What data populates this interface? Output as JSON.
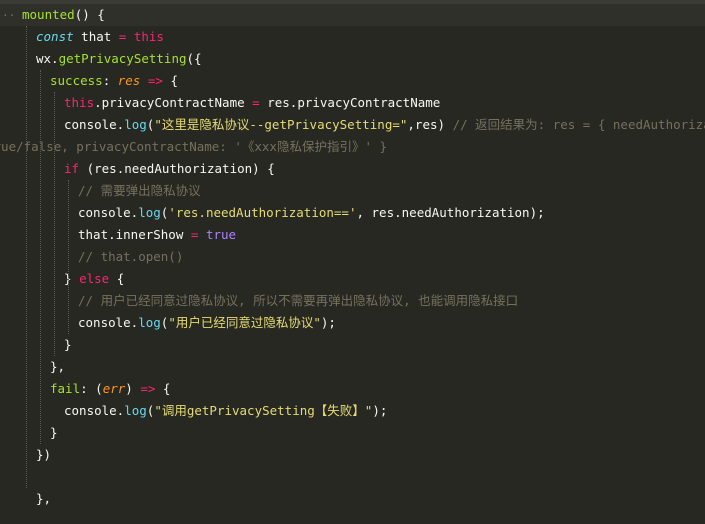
{
  "editor": {
    "colors": {
      "background": "#272822",
      "active_line": "#2f302a",
      "keyword": "#f92672",
      "storage": "#66d9ef",
      "function": "#a6e22e",
      "text": "#f8f8f2",
      "string": "#e6db74",
      "boolean": "#ae81ff",
      "comment": "#75715e",
      "parameter": "#fd971f"
    },
    "fold_marker": "··",
    "lines": [
      {
        "indent": 0,
        "tokens": [
          [
            "fn",
            "mounted"
          ],
          [
            "plain",
            "() {"
          ]
        ]
      },
      {
        "indent": 1,
        "tokens": [
          [
            "stg",
            "const"
          ],
          [
            "plain",
            " that "
          ],
          [
            "kw",
            "="
          ],
          [
            "plain",
            " "
          ],
          [
            "thisk",
            "this"
          ]
        ]
      },
      {
        "indent": 1,
        "tokens": [
          [
            "plain",
            "wx."
          ],
          [
            "fn",
            "getPrivacySetting"
          ],
          [
            "plain",
            "({"
          ]
        ]
      },
      {
        "indent": 2,
        "tokens": [
          [
            "fn",
            "success"
          ],
          [
            "plain",
            ": "
          ],
          [
            "prm",
            "res"
          ],
          [
            "plain",
            " "
          ],
          [
            "kw",
            "=>"
          ],
          [
            "plain",
            " {"
          ]
        ]
      },
      {
        "indent": 3,
        "tokens": [
          [
            "thisk",
            "this"
          ],
          [
            "plain",
            ".privacyContractName "
          ],
          [
            "kw",
            "="
          ],
          [
            "plain",
            " res.privacyContractName"
          ]
        ]
      },
      {
        "indent": 3,
        "tokens": [
          [
            "plain",
            "console."
          ],
          [
            "lib",
            "log"
          ],
          [
            "plain",
            "("
          ],
          [
            "str",
            "\"这里是隐私协议--getPrivacySetting=\""
          ],
          [
            "plain",
            ",res) "
          ],
          [
            "cmt",
            "// 返回结果为: res = { needAuthorization:"
          ]
        ]
      },
      {
        "indent": 0,
        "offset": -14,
        "tokens": [
          [
            "cmt",
            "true/false, privacyContractName: '《xxx隐私保护指引》' }"
          ]
        ]
      },
      {
        "indent": 3,
        "tokens": [
          [
            "kw",
            "if"
          ],
          [
            "plain",
            " (res.needAuthorization) {"
          ]
        ]
      },
      {
        "indent": 4,
        "tokens": [
          [
            "cmt",
            "// 需要弹出隐私协议"
          ]
        ]
      },
      {
        "indent": 4,
        "tokens": [
          [
            "plain",
            "console."
          ],
          [
            "lib",
            "log"
          ],
          [
            "plain",
            "("
          ],
          [
            "str",
            "'res.needAuthorization=='"
          ],
          [
            "plain",
            ", res.needAuthorization);"
          ]
        ]
      },
      {
        "indent": 4,
        "tokens": [
          [
            "plain",
            "that.innerShow "
          ],
          [
            "kw",
            "="
          ],
          [
            "plain",
            " "
          ],
          [
            "num",
            "true"
          ]
        ]
      },
      {
        "indent": 4,
        "tokens": [
          [
            "cmt",
            "// that.open()"
          ]
        ]
      },
      {
        "indent": 3,
        "tokens": [
          [
            "plain",
            "} "
          ],
          [
            "kw",
            "else"
          ],
          [
            "plain",
            " {"
          ]
        ]
      },
      {
        "indent": 4,
        "tokens": [
          [
            "cmt",
            "// 用户已经同意过隐私协议, 所以不需要再弹出隐私协议, 也能调用隐私接口"
          ]
        ]
      },
      {
        "indent": 4,
        "tokens": [
          [
            "plain",
            "console."
          ],
          [
            "lib",
            "log"
          ],
          [
            "plain",
            "("
          ],
          [
            "str",
            "\"用户已经同意过隐私协议\""
          ],
          [
            "plain",
            ");"
          ]
        ]
      },
      {
        "indent": 3,
        "tokens": [
          [
            "plain",
            "}"
          ]
        ]
      },
      {
        "indent": 2,
        "tokens": [
          [
            "plain",
            "},"
          ]
        ]
      },
      {
        "indent": 2,
        "tokens": [
          [
            "fn",
            "fail"
          ],
          [
            "plain",
            ": ("
          ],
          [
            "prm",
            "err"
          ],
          [
            "plain",
            ") "
          ],
          [
            "kw",
            "=>"
          ],
          [
            "plain",
            " {"
          ]
        ]
      },
      {
        "indent": 3,
        "tokens": [
          [
            "plain",
            "console."
          ],
          [
            "lib",
            "log"
          ],
          [
            "plain",
            "("
          ],
          [
            "str",
            "\"调用getPrivacySetting【失败】\""
          ],
          [
            "plain",
            ");"
          ]
        ]
      },
      {
        "indent": 2,
        "tokens": [
          [
            "plain",
            "}"
          ]
        ]
      },
      {
        "indent": 1,
        "tokens": [
          [
            "plain",
            "})"
          ]
        ]
      },
      {
        "indent": 0,
        "tokens": []
      },
      {
        "indent": 1,
        "tokens": [
          [
            "plain",
            "},"
          ]
        ]
      }
    ]
  }
}
